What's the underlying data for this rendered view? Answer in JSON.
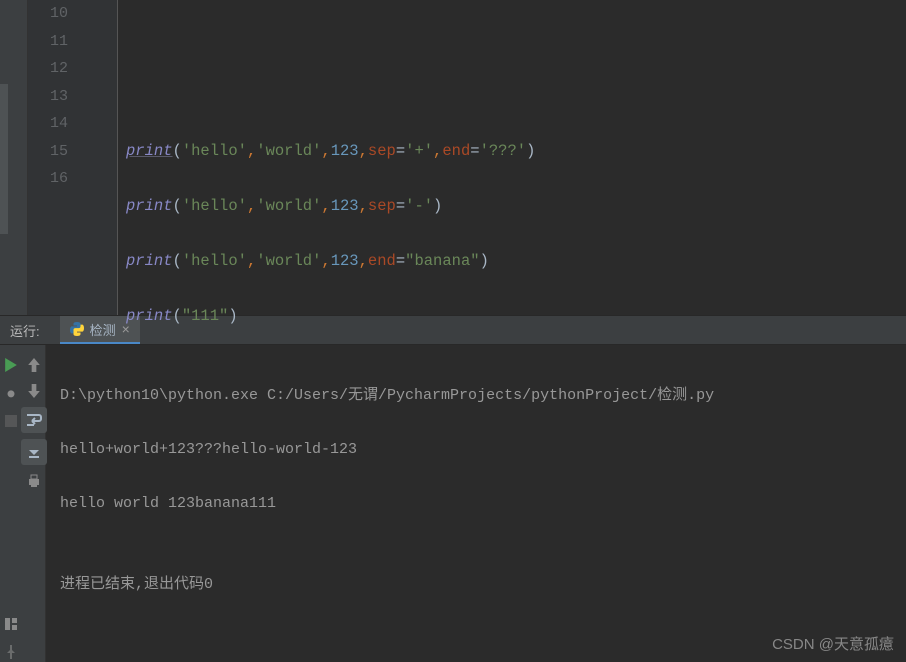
{
  "editor": {
    "lines": [
      "10",
      "11",
      "12",
      "13",
      "14",
      "15",
      "16"
    ],
    "code": {
      "l12": {
        "fn": "print",
        "s1": "'hello'",
        "s2": "'world'",
        "n": "123",
        "sep": "sep",
        "sv": "'+'",
        "end": "end",
        "ev": "'???'"
      },
      "l13": {
        "fn": "print",
        "s1": "'hello'",
        "s2": "'world'",
        "n": "123",
        "sep": "sep",
        "sv": "'-'"
      },
      "l14": {
        "fn": "print",
        "s1": "'hello'",
        "s2": "'world'",
        "n": "123",
        "end": "end",
        "ev": "\"banana\""
      },
      "l15": {
        "fn": "print",
        "s": "\"111\""
      }
    }
  },
  "run": {
    "label": "运行:",
    "tab_name": "检测",
    "console": {
      "l1": "D:\\python10\\python.exe C:/Users/无谓/PycharmProjects/pythonProject/检测.py",
      "l2": "hello+world+123???hello-world-123",
      "l3": "hello world 123banana111",
      "l4": "",
      "l5": "进程已结束,退出代码0"
    }
  },
  "watermark": "CSDN @天意孤癔"
}
